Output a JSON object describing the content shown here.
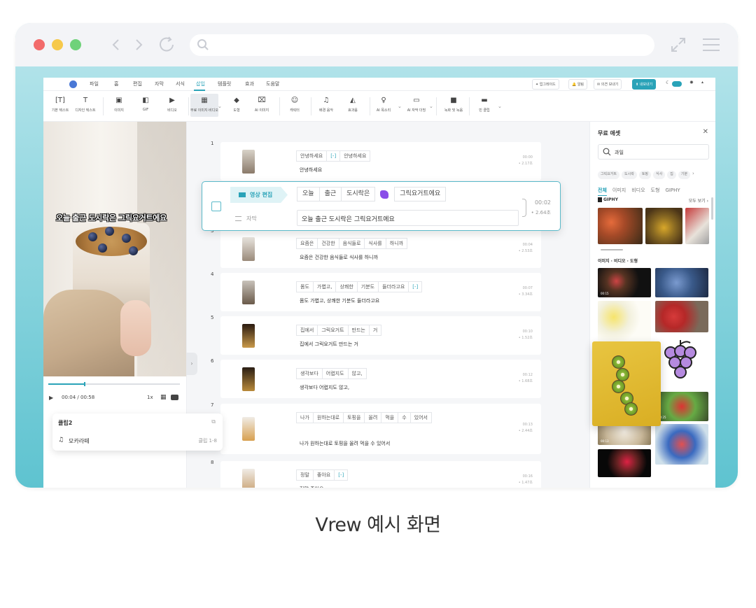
{
  "app": {
    "menu": [
      "파일",
      "홈",
      "편집",
      "자막",
      "서식",
      "삽입",
      "템플릿",
      "효과",
      "도움말"
    ],
    "active_menu": "삽입",
    "top_buttons": [
      "업그레이드",
      "알림",
      "의견 보내기",
      "내보내기"
    ],
    "toolbar": [
      {
        "label": "기본 텍스트",
        "icon": "text-icon"
      },
      {
        "label": "디자인 텍스트",
        "icon": "design-text-icon"
      },
      {
        "label": "이미지",
        "icon": "image-icon"
      },
      {
        "label": "GIF",
        "icon": "gif-icon"
      },
      {
        "label": "비디오",
        "icon": "video-icon"
      },
      {
        "label": "무료 이미지·비디오",
        "icon": "free-asset-icon"
      },
      {
        "label": "도형",
        "icon": "shape-icon"
      },
      {
        "label": "AI 이미지",
        "icon": "ai-image-icon"
      },
      {
        "label": "캐릭터",
        "icon": "character-icon"
      },
      {
        "label": "배경 음악",
        "icon": "music-icon"
      },
      {
        "label": "효과음",
        "icon": "sound-effect-icon"
      },
      {
        "label": "AI 목소리",
        "icon": "ai-voice-icon"
      },
      {
        "label": "AI 자막 더빙",
        "icon": "ai-dubbing-icon"
      },
      {
        "label": "녹화 및 녹음",
        "icon": "record-icon"
      },
      {
        "label": "빈 클립",
        "icon": "blank-clip-icon"
      }
    ]
  },
  "preview": {
    "overlay_subtitle": "오늘 출근 도시락은 그릭요거트에요",
    "current_time": "00:04",
    "total_time": "/ 00:58",
    "progress": 0.27,
    "speed": "1x"
  },
  "clip_popup": {
    "title": "클립2",
    "music_name": "모카라떼",
    "range": "클립 1-8"
  },
  "clips": [
    {
      "num": "1",
      "words": [
        "안녕하세요",
        "[-]",
        "안녕하세요"
      ],
      "text": "안녕하세요",
      "time": "00:00",
      "dur": "• 2.17초"
    },
    {
      "num": "3",
      "words": [
        "요즘은",
        "건강한",
        "음식들로",
        "식사를",
        "하니까"
      ],
      "text": "요즘은 건강한 음식들로 식사를 하니까",
      "time": "00:04",
      "dur": "• 2.53초"
    },
    {
      "num": "4",
      "words": [
        "몸도",
        "가볍고,",
        "상쾌한",
        "기분도",
        "들더라고요",
        "[-]"
      ],
      "text": "몸도 가볍고, 상쾌한 기분도 들더라고요",
      "time": "00:07",
      "dur": "• 3.34초"
    },
    {
      "num": "5",
      "words": [
        "집에서",
        "그릭요거트",
        "만드는",
        "거"
      ],
      "text": "집에서 그릭요거트 만드는 거",
      "time": "00:10",
      "dur": "• 1.52초"
    },
    {
      "num": "6",
      "words": [
        "생각보다",
        "어렵지도",
        "않고,"
      ],
      "text": "생각보다 어렵지도 않고,",
      "time": "00:12",
      "dur": "• 1.68초"
    },
    {
      "num": "7",
      "words": [
        "나가",
        "원하는대로",
        "토핑을",
        "올려",
        "먹을",
        "수",
        "있어서"
      ],
      "text": "나가 원하는대로 토핑을 올려 먹을 수 있어서",
      "time": "00:13",
      "dur": "• 2.44초"
    },
    {
      "num": "8",
      "words": [
        "정말",
        "좋아요",
        "[-]"
      ],
      "text": "정말 좋아요",
      "time": "00:16",
      "dur": "• 1.47초"
    }
  ],
  "highlight_clip": {
    "tag": "영상 편집",
    "words": [
      "오늘",
      "출근",
      "도시락은",
      "그릭요거트에요"
    ],
    "sub_label": "자막",
    "subtitle": "오늘 출근 도시락은 그릭요거트에요",
    "time": "00:02",
    "dur": "• 2.64초"
  },
  "assets": {
    "title": "무료 애셋",
    "search_value": "과일",
    "chips": [
      "그릭요거트",
      "도시락",
      "토핑",
      "식사",
      "집",
      "기분"
    ],
    "tabs": [
      "전체",
      "이미지",
      "비디오",
      "도형",
      "GIPHY"
    ],
    "giphy_label": "GIPHY",
    "see_all": "모두 보기",
    "section_label": "이미지 · 비디오 · 도형",
    "durations": [
      "00:15",
      "00:25",
      "00:13"
    ]
  },
  "caption": "Vrew 예시 화면"
}
